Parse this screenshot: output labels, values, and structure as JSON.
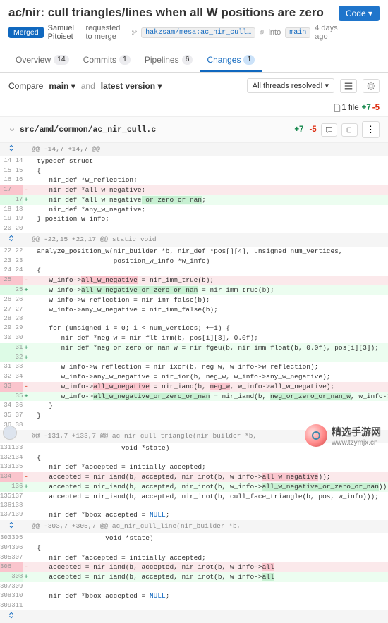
{
  "header": {
    "title": "ac/nir: cull triangles/lines when all W positions are zero",
    "merged_label": "Merged",
    "author": "Samuel Pitoiset",
    "requested": "requested to merge",
    "src_branch": "hakzsam/mesa:ac_nir_cull…",
    "into": "into",
    "tgt_branch": "main",
    "time": "4 days ago",
    "code_btn": "Code"
  },
  "tabs": [
    {
      "label": "Overview",
      "count": "14"
    },
    {
      "label": "Commits",
      "count": "1"
    },
    {
      "label": "Pipelines",
      "count": "6"
    },
    {
      "label": "Changes",
      "count": "1"
    }
  ],
  "toolbar": {
    "compare": "Compare",
    "main": "main",
    "and": "and",
    "latest": "latest version",
    "resolved": "All threads resolved!"
  },
  "filebar": {
    "count_prefix": "1 file",
    "plus": "+7",
    "minus": "-5"
  },
  "file": {
    "path": "src/amd/common/ac_nir_cull.c",
    "plus": "+7",
    "minus": "-5"
  },
  "hunks": [
    {
      "header": "@@ -14,7 +14,7 @@",
      "lines": [
        {
          "t": "ctx",
          "o": "14",
          "n": "14",
          "c": "  typedef struct"
        },
        {
          "t": "ctx",
          "o": "15",
          "n": "15",
          "c": "  {"
        },
        {
          "t": "ctx",
          "o": "16",
          "n": "16",
          "c": "     nir_def *w_reflection;"
        },
        {
          "t": "del",
          "o": "17",
          "n": "",
          "c": "     nir_def *all_w_negative;"
        },
        {
          "t": "add",
          "o": "",
          "n": "17",
          "c": "     nir_def *all_w_negative_or_zero_or_nan;",
          "hl": [
            "_or_zero_or_nan"
          ]
        },
        {
          "t": "ctx",
          "o": "18",
          "n": "18",
          "c": "     nir_def *any_w_negative;"
        },
        {
          "t": "ctx",
          "o": "19",
          "n": "19",
          "c": "  } position_w_info;"
        },
        {
          "t": "ctx",
          "o": "20",
          "n": "20",
          "c": ""
        }
      ]
    },
    {
      "header": "@@ -22,15 +22,17 @@ static void",
      "lines": [
        {
          "t": "ctx",
          "o": "22",
          "n": "22",
          "c": "  analyze_position_w(nir_builder *b, nir_def *pos[][4], unsigned num_vertices,"
        },
        {
          "t": "ctx",
          "o": "23",
          "n": "23",
          "c": "                     position_w_info *w_info)"
        },
        {
          "t": "ctx",
          "o": "24",
          "n": "24",
          "c": "  {"
        },
        {
          "t": "del",
          "o": "25",
          "n": "",
          "c": "     w_info->all_w_negative = nir_imm_true(b);",
          "hl": [
            "all_w_negative"
          ]
        },
        {
          "t": "add",
          "o": "",
          "n": "25",
          "c": "     w_info->all_w_negative_or_zero_or_nan = nir_imm_true(b);",
          "hl": [
            "all_w_negative_or_zero_or_nan"
          ]
        },
        {
          "t": "ctx",
          "o": "26",
          "n": "26",
          "c": "     w_info->w_reflection = nir_imm_false(b);"
        },
        {
          "t": "ctx",
          "o": "27",
          "n": "27",
          "c": "     w_info->any_w_negative = nir_imm_false(b);"
        },
        {
          "t": "ctx",
          "o": "28",
          "n": "28",
          "c": ""
        },
        {
          "t": "ctx",
          "o": "29",
          "n": "29",
          "c": "     for (unsigned i = 0; i < num_vertices; ++i) {"
        },
        {
          "t": "ctx",
          "o": "30",
          "n": "30",
          "c": "        nir_def *neg_w = nir_flt_imm(b, pos[i][3], 0.0f);"
        },
        {
          "t": "add",
          "o": "",
          "n": "31",
          "c": "        nir_def *neg_or_zero_or_nan_w = nir_fgeu(b, nir_imm_float(b, 0.0f), pos[i][3]);"
        },
        {
          "t": "add",
          "o": "",
          "n": "32",
          "c": ""
        },
        {
          "t": "ctx",
          "o": "31",
          "n": "33",
          "c": "        w_info->w_reflection = nir_ixor(b, neg_w, w_info->w_reflection);"
        },
        {
          "t": "ctx",
          "o": "32",
          "n": "34",
          "c": "        w_info->any_w_negative = nir_ior(b, neg_w, w_info->any_w_negative);"
        },
        {
          "t": "del",
          "o": "33",
          "n": "",
          "c": "        w_info->all_w_negative = nir_iand(b, neg_w, w_info->all_w_negative);",
          "hl": [
            "all_w_negative",
            "neg_w",
            "all_w_negative"
          ]
        },
        {
          "t": "add",
          "o": "",
          "n": "35",
          "c": "        w_info->all_w_negative_or_zero_or_nan = nir_iand(b, neg_or_zero_or_nan_w, w_info->all_w_negative_or_zero_or_nan);",
          "hl": [
            "all_w_negative_or_zero_or_nan",
            "neg_or_zero_or_nan_w",
            "all_w_negative_or_zero_or_nan"
          ]
        },
        {
          "t": "ctx",
          "o": "34",
          "n": "36",
          "c": "     }"
        },
        {
          "t": "ctx",
          "o": "35",
          "n": "37",
          "c": "  }"
        },
        {
          "t": "ctx",
          "o": "36",
          "n": "38",
          "c": ""
        }
      ]
    },
    {
      "header": "@@ -131,7 +133,7 @@ ac_nir_cull_triangle(nir_builder *b,",
      "lines": [
        {
          "t": "ctx",
          "o": "131",
          "n": "133",
          "c": "                       void *state)"
        },
        {
          "t": "ctx",
          "o": "132",
          "n": "134",
          "c": "  {"
        },
        {
          "t": "ctx",
          "o": "133",
          "n": "135",
          "c": "     nir_def *accepted = initially_accepted;"
        },
        {
          "t": "del",
          "o": "134",
          "n": "",
          "c": "     accepted = nir_iand(b, accepted, nir_inot(b, w_info->all_w_negative));",
          "hl": [
            "all_w_negative"
          ]
        },
        {
          "t": "add",
          "o": "",
          "n": "136",
          "c": "     accepted = nir_iand(b, accepted, nir_inot(b, w_info->all_w_negative_or_zero_or_nan));",
          "hl": [
            "all_w_negative_or_zero_or_nan"
          ]
        },
        {
          "t": "ctx",
          "o": "135",
          "n": "137",
          "c": "     accepted = nir_iand(b, accepted, nir_inot(b, cull_face_triangle(b, pos, w_info)));"
        },
        {
          "t": "ctx",
          "o": "136",
          "n": "138",
          "c": ""
        },
        {
          "t": "ctx",
          "o": "137",
          "n": "139",
          "c": "     nir_def *bbox_accepted = NULL;"
        }
      ]
    },
    {
      "header": "@@ -303,7 +305,7 @@ ac_nir_cull_line(nir_builder *b,",
      "lines": [
        {
          "t": "ctx",
          "o": "303",
          "n": "305",
          "c": "                   void *state)"
        },
        {
          "t": "ctx",
          "o": "304",
          "n": "306",
          "c": "  {"
        },
        {
          "t": "ctx",
          "o": "305",
          "n": "307",
          "c": "     nir_def *accepted = initially_accepted;"
        },
        {
          "t": "del",
          "o": "306",
          "n": "",
          "c": "     accepted = nir_iand(b, accepted, nir_inot(b, w_info->all",
          "hl": [
            "all"
          ]
        },
        {
          "t": "add",
          "o": "",
          "n": "308",
          "c": "     accepted = nir_iand(b, accepted, nir_inot(b, w_info->all",
          "hl": [
            "all"
          ]
        },
        {
          "t": "ctx",
          "o": "307",
          "n": "309",
          "c": ""
        },
        {
          "t": "ctx",
          "o": "308",
          "n": "310",
          "c": "     nir_def *bbox_accepted = NULL;"
        },
        {
          "t": "ctx",
          "o": "309",
          "n": "311",
          "c": ""
        }
      ]
    }
  ],
  "watermark": {
    "text": "精选手游网",
    "url": "www.tzymjx.cn"
  }
}
